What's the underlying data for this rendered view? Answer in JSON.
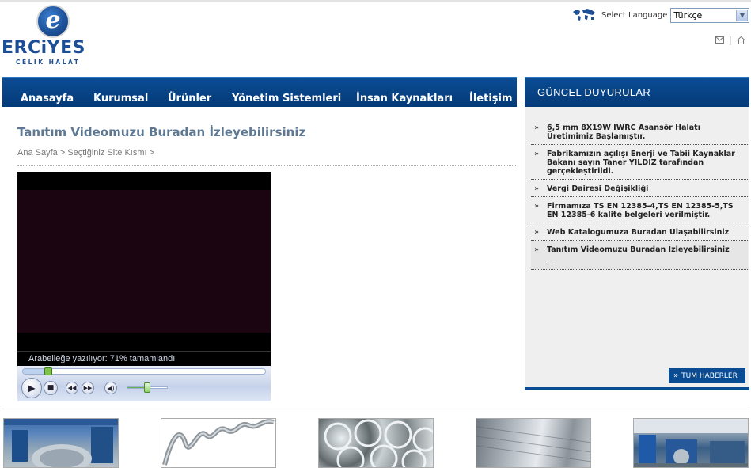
{
  "logo": {
    "word": "ERCiYES",
    "sub": "CELIK HALAT"
  },
  "language": {
    "label": "Select Language",
    "selected": "Türkçe"
  },
  "nav": {
    "items": [
      "Anasayfa",
      "Kurumsal",
      "Ürünler",
      "Yönetim Sistemleri",
      "İnsan Kaynakları",
      "İletişim"
    ]
  },
  "main": {
    "title": "Tanıtım Videomuzu Buradan İzleyebilirsiniz",
    "breadcrumb": "Ana Sayfa > Seçtiğiniz Site Kısmı >"
  },
  "player": {
    "status": "Arabelleğe yazılıyor: 71% tamamlandı",
    "buffer_percent": 71,
    "seek_position": 0.1,
    "volume_level": 0.5
  },
  "news": {
    "header": "GÜNCEL DUYURULAR",
    "items": [
      "6,5 mm 8X19W IWRC Asansör Halatı Üretimimiz Başlamıştır.",
      "Fabrikamızın açılışı Enerji ve Tabii Kaynaklar Bakanı sayın Taner YILDIZ tarafından gerçekleştirildi.",
      "Vergi Dairesi Değişikliği",
      "Firmamıza TS EN 12385-4,TS EN 12385-5,TS EN 12385-6 kalite belgeleri verilmiştir.",
      "Web Katalogumuza Buradan Ulaşabilirsiniz",
      "Tanıtım Videomuzu Buradan İzleyebilirsiniz"
    ],
    "more": "...",
    "all_button": "TUM HABERLER"
  },
  "icons": {
    "globe": "globe-icon",
    "mail": "mail-icon",
    "home": "home-icon"
  },
  "colors": {
    "brand_blue": "#0a4c93",
    "title_blue": "#5c7893"
  }
}
